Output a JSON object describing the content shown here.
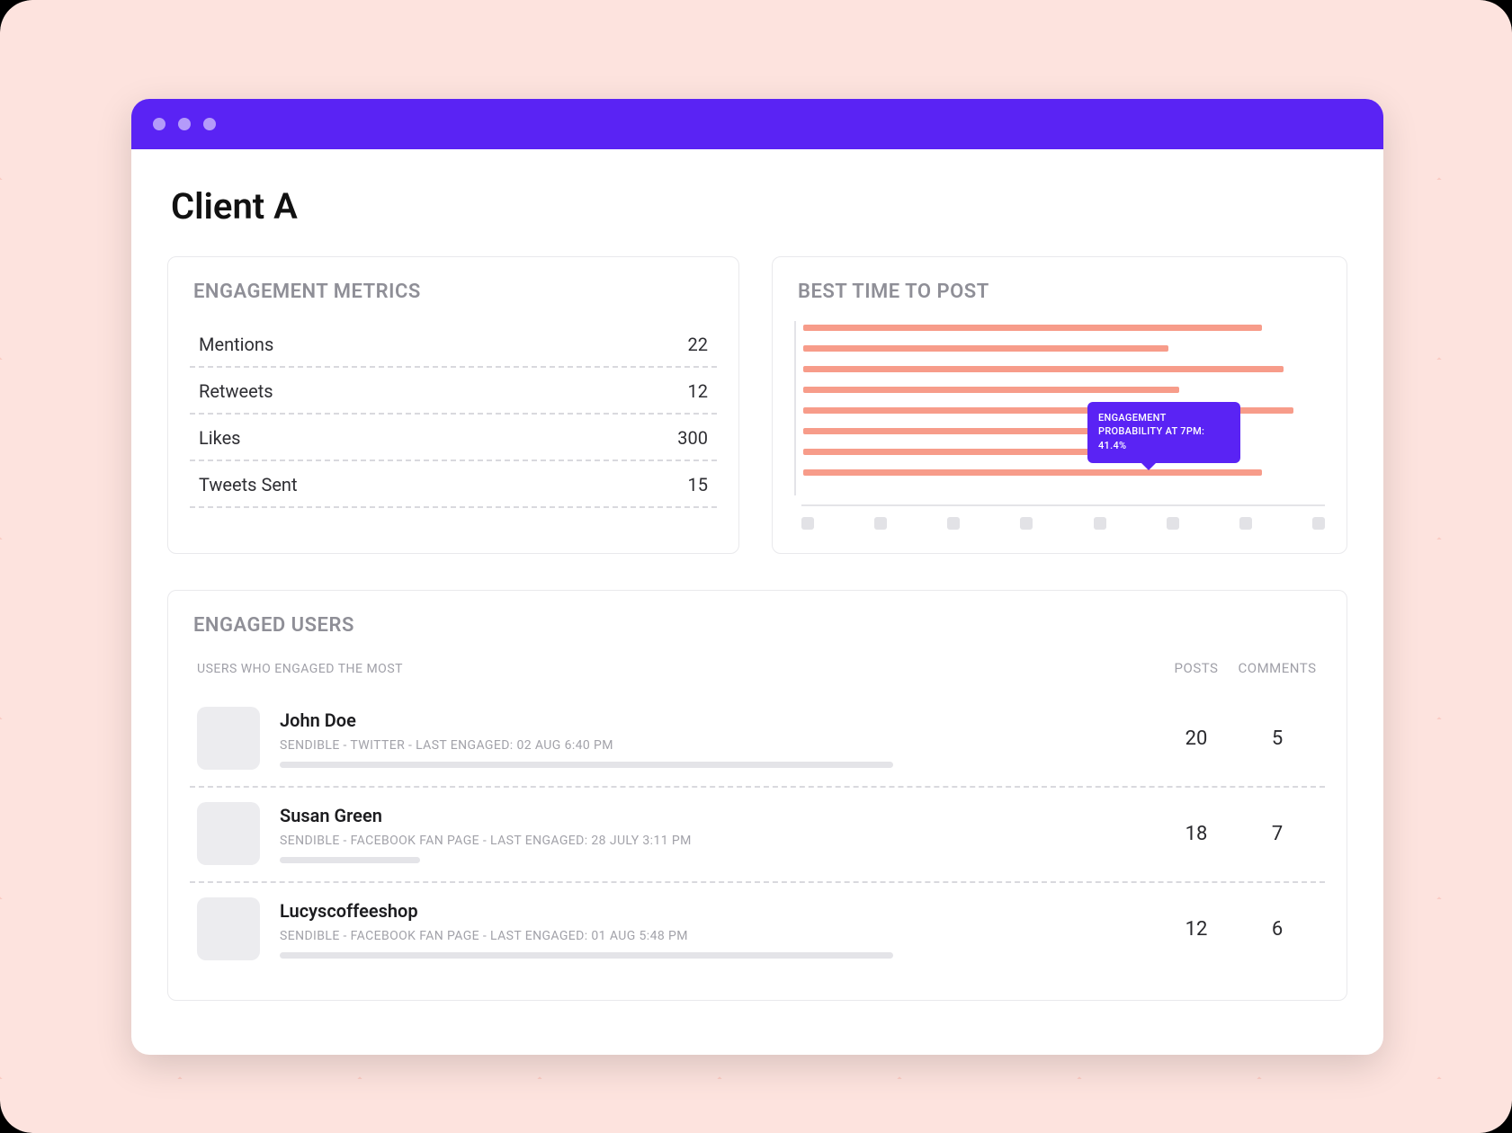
{
  "page": {
    "title": "Client A"
  },
  "metrics": {
    "title": "ENGAGEMENT METRICS",
    "rows": [
      {
        "label": "Mentions",
        "value": "22"
      },
      {
        "label": "Retweets",
        "value": "12"
      },
      {
        "label": "Likes",
        "value": "300"
      },
      {
        "label": "Tweets Sent",
        "value": "15"
      }
    ]
  },
  "best_time": {
    "title": "BEST TIME TO POST",
    "tooltip_line1": "ENGAGEMENT",
    "tooltip_line2": "PROBABILITY AT 7PM:",
    "tooltip_value": "41.4%"
  },
  "chart_data": {
    "type": "bar",
    "orientation": "horizontal",
    "title": "BEST TIME TO POST",
    "xlabel": "",
    "ylabel": "",
    "categories": [
      "",
      "",
      "",
      "",
      "",
      "",
      "",
      ""
    ],
    "series": [
      {
        "name": "Engagement probability",
        "values": [
          88,
          70,
          92,
          72,
          94,
          62,
          74,
          88
        ]
      }
    ],
    "annotation": {
      "index": 5,
      "text": "ENGAGEMENT PROBABILITY AT 7PM: 41.4%"
    },
    "ticks": 8,
    "xlim": [
      0,
      100
    ]
  },
  "engaged": {
    "title": "ENGAGED USERS",
    "subtitle": "USERS WHO ENGAGED THE MOST",
    "col_posts": "POSTS",
    "col_comments": "COMMENTS",
    "users": [
      {
        "name": "John Doe",
        "meta": "SENDIBLE - TWITTER - LAST ENGAGED: 02 AUG 6:40 PM",
        "posts": "20",
        "comments": "5",
        "bar_pct": 70
      },
      {
        "name": "Susan Green",
        "meta": "SENDIBLE - FACEBOOK FAN PAGE - LAST ENGAGED: 28 JULY 3:11 PM",
        "posts": "18",
        "comments": "7",
        "bar_pct": 16
      },
      {
        "name": "Lucyscoffeeshop",
        "meta": "SENDIBLE - FACEBOOK FAN PAGE - LAST ENGAGED: 01 AUG 5:48 PM",
        "posts": "12",
        "comments": "6",
        "bar_pct": 70
      }
    ]
  }
}
